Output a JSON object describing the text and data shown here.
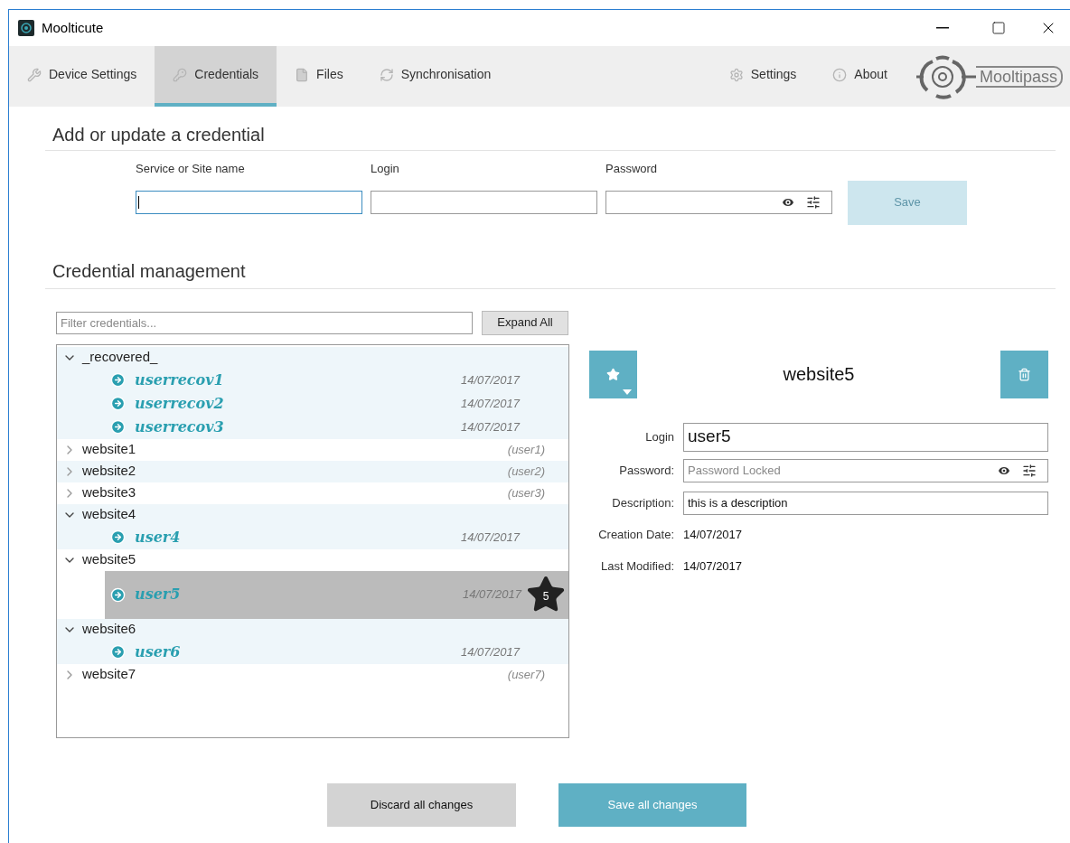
{
  "window": {
    "title": "Moolticute"
  },
  "tabs": [
    {
      "label": "Device Settings",
      "selected": false
    },
    {
      "label": "Credentials",
      "selected": true
    },
    {
      "label": "Files",
      "selected": false
    },
    {
      "label": "Synchronisation",
      "selected": false
    }
  ],
  "right_tabs": [
    {
      "label": "Settings",
      "selected": false
    },
    {
      "label": "About",
      "selected": false
    }
  ],
  "logo": {
    "text": "Mooltipass"
  },
  "add_section": {
    "title": "Add or update a credential",
    "fields": [
      {
        "label": "Service or Site name",
        "kind": "text",
        "focused": true
      },
      {
        "label": "Login",
        "kind": "text",
        "focused": false
      },
      {
        "label": "Password",
        "kind": "password",
        "focused": false
      }
    ],
    "save_button": {
      "label": "Save",
      "disabled": true
    }
  },
  "management": {
    "title": "Credential management",
    "filter": {
      "placeholder": "Filter credentials..."
    },
    "expand_button": "Expand All",
    "tree": [
      {
        "name": "_recovered_",
        "expanded": true,
        "children": [
          {
            "login": "userrecov1",
            "date": "14/07/2017",
            "selected": false
          },
          {
            "login": "userrecov2",
            "date": "14/07/2017",
            "selected": false
          },
          {
            "login": "userrecov3",
            "date": "14/07/2017",
            "selected": false
          }
        ]
      },
      {
        "name": "website1",
        "expanded": false,
        "hint": "(user1)"
      },
      {
        "name": "website2",
        "expanded": false,
        "hint": "(user2)"
      },
      {
        "name": "website3",
        "expanded": false,
        "hint": "(user3)"
      },
      {
        "name": "website4",
        "expanded": true,
        "children": [
          {
            "login": "user4",
            "date": "14/07/2017",
            "selected": false
          }
        ]
      },
      {
        "name": "website5",
        "expanded": true,
        "children": [
          {
            "login": "user5",
            "date": "14/07/2017",
            "selected": true,
            "favorite": "5"
          }
        ]
      },
      {
        "name": "website6",
        "expanded": true,
        "children": [
          {
            "login": "user6",
            "date": "14/07/2017",
            "selected": false
          }
        ]
      },
      {
        "name": "website7",
        "expanded": false,
        "hint": "(user7)"
      }
    ],
    "details": {
      "title": "website5",
      "login": {
        "label": "Login",
        "value": "user5"
      },
      "password": {
        "label": "Password:",
        "placeholder": "Password Locked"
      },
      "description": {
        "label": "Description:",
        "value": "this is a description"
      },
      "creation": {
        "label": "Creation Date:",
        "value": "14/07/2017"
      },
      "modified": {
        "label": "Last Modified:",
        "value": "14/07/2017"
      }
    }
  },
  "footer": {
    "discard": "Discard all changes",
    "save": "Save all changes"
  }
}
